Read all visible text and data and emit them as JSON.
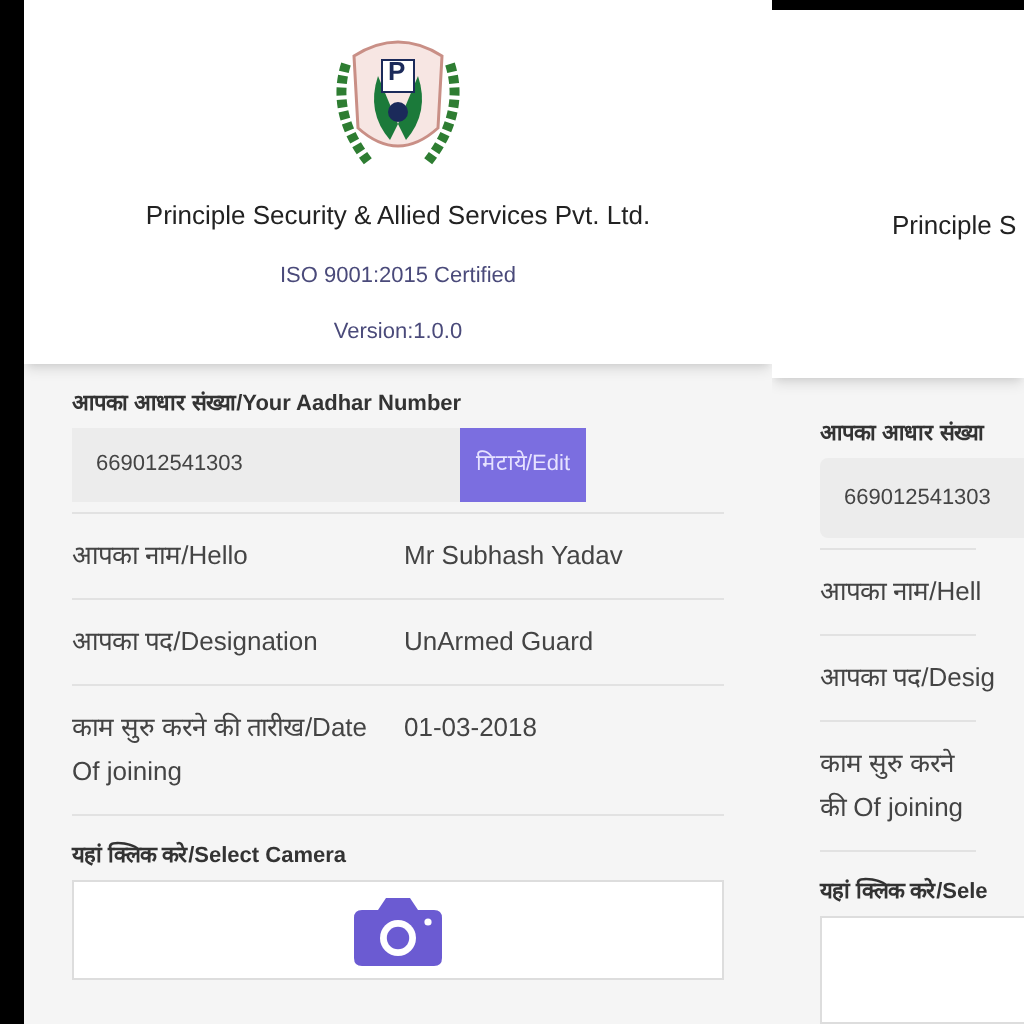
{
  "screens": [
    {
      "logo_letter": "P",
      "title": "Principle Security & Allied Services Pvt. Ltd.",
      "certification": "ISO 9001:2015 Certified",
      "version": "Version:1.0.0",
      "aadhar": {
        "label": "आपका आधार संख्या/Your Aadhar Number",
        "value": "669012541303",
        "button": "मिटाये/Edit"
      },
      "rows": [
        {
          "label": "आपका नाम/Hello",
          "value": "Mr Subhash Yadav"
        },
        {
          "label": "आपका पद/Designation",
          "value": "UnArmed Guard"
        },
        {
          "label": "काम सुरु करने की तारीख/Date Of joining",
          "value": "01-03-2018"
        }
      ],
      "camera": {
        "label": "यहां क्लिक करे/Select Camera"
      }
    },
    {
      "title": "Principle S",
      "aadhar": {
        "label": "आपका आधार संख्या",
        "value": "669012541303"
      },
      "rows": [
        {
          "label": "आपका नाम/Hell"
        },
        {
          "label": "आपका पद/Desig"
        },
        {
          "label": "काम सुरु करने की Of joining"
        }
      ],
      "camera": {
        "label": "यहां क्लिक करे/Sele"
      }
    }
  ]
}
